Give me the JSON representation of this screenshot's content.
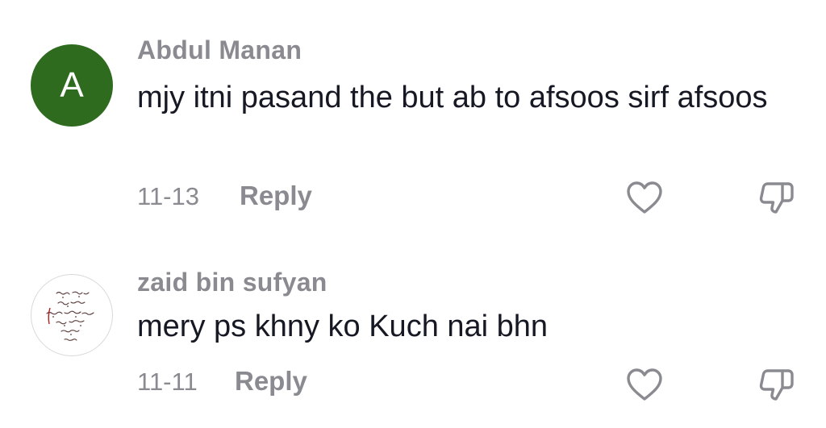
{
  "comments": [
    {
      "avatar_letter": "A",
      "avatar_color": "#2e6b1f",
      "username": "Abdul Manan",
      "text": "mjy itni pasand the but ab to afsoos sirf afsoos",
      "date": "11-13",
      "reply_label": "Reply",
      "like_icon": "heart-outline-icon",
      "dislike_icon": "thumbs-down-icon"
    },
    {
      "avatar_kind": "urdu-calligraphy-image",
      "username": "zaid bin sufyan",
      "text": "mery ps khny ko Kuch nai bhn",
      "date": "11-11",
      "reply_label": "Reply",
      "like_icon": "heart-outline-icon",
      "dislike_icon": "thumbs-down-icon"
    }
  ],
  "colors": {
    "secondary_text": "#8a8b91",
    "primary_text": "#161823",
    "icon_stroke": "#8a8b91"
  }
}
